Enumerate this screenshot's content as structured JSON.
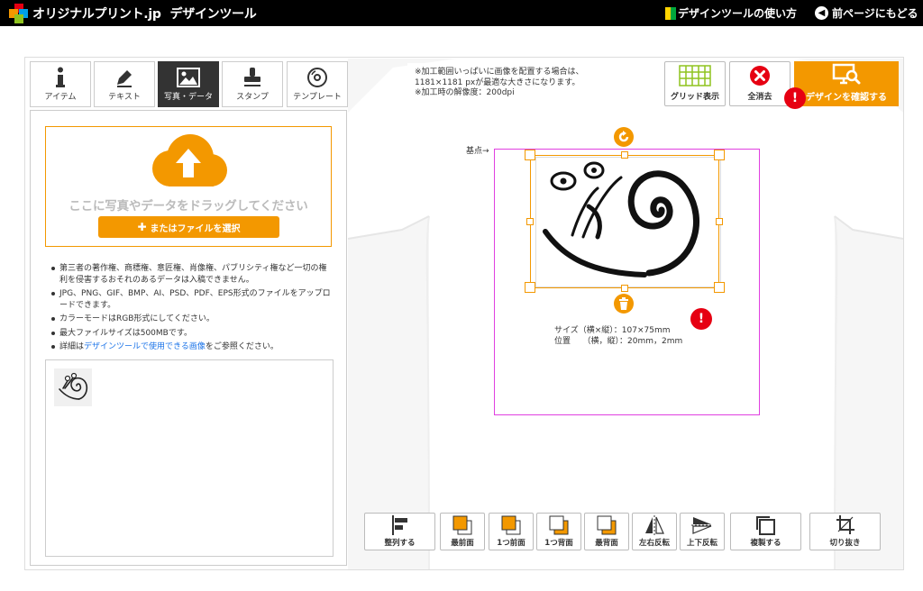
{
  "header": {
    "site_name": "オリジナルプリント.jp",
    "tool_name": "デザインツール",
    "howto_label": "デザインツールの使い方",
    "back_label": "前ページにもどる"
  },
  "tabs": [
    {
      "label": "アイテム",
      "icon": "info-icon"
    },
    {
      "label": "テキスト",
      "icon": "pen-icon"
    },
    {
      "label": "写真・データ",
      "icon": "image-icon",
      "active": true
    },
    {
      "label": "スタンプ",
      "icon": "stamp-icon"
    },
    {
      "label": "テンプレート",
      "icon": "disc-icon"
    }
  ],
  "upload": {
    "drop_text": "ここに写真やデータをドラッグしてください",
    "file_button": "またはファイルを選択"
  },
  "notes": {
    "n1": "第三者の著作権、商標権、意匠権、肖像権、パブリシティ権など一切の権利を侵害するおそれのあるデータは入稿できません。",
    "n2": "JPG、PNG、GIF、BMP、AI、PSD、PDF、EPS形式のファイルをアップロードできます。",
    "n3": "カラーモードはRGB形式にしてください。",
    "n4": "最大ファイルサイズは500MBです。",
    "n5_pre": "詳細は",
    "n5_link": "デザインツールで使用できる画像",
    "n5_post": "をご参照ください。"
  },
  "hint": {
    "line1": "※加工範囲いっぱいに画像を配置する場合は、",
    "line2": "1181×1181 pxが最適な大きさになります。",
    "line3": "※加工時の解像度：200dpi"
  },
  "toolbar": {
    "grid_label": "グリッド表示",
    "clear_label": "全消去",
    "confirm_label": "デザインを確認する"
  },
  "canvas": {
    "origin_label": "基点→",
    "size_label": "サイズ（横×縦）：107×75mm",
    "position_label": "位置　　（横，縦）：20mm，2mm"
  },
  "bottom_tools": {
    "align": "整列する",
    "front_most": "最前面",
    "forward": "1つ前面",
    "backward": "1つ背面",
    "back_most": "最背面",
    "flip_h": "左右反転",
    "flip_v": "上下反転",
    "duplicate": "複製する",
    "crop": "切り抜き"
  },
  "colors": {
    "accent": "#f39800",
    "alert": "#e60012",
    "print_area": "#e040e0"
  }
}
